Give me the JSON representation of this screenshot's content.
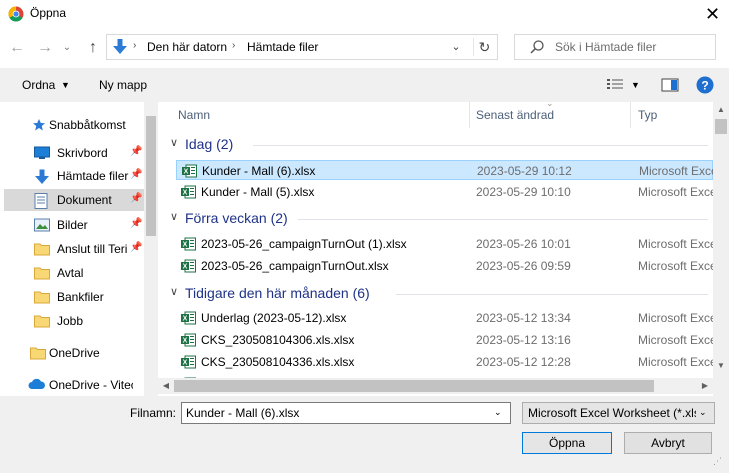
{
  "window": {
    "title": "Öppna"
  },
  "address": {
    "crumbs": [
      "Den här datorn",
      "Hämtade filer"
    ]
  },
  "search": {
    "placeholder": "Sök i Hämtade filer"
  },
  "toolbar": {
    "organize": "Ordna",
    "new_folder": "Ny mapp"
  },
  "nav": {
    "items": [
      {
        "label": "Snabbåtkomst",
        "icon": "star-icon"
      },
      {
        "label": "Skrivbord",
        "icon": "desktop-icon"
      },
      {
        "label": "Hämtade filer",
        "icon": "download-icon"
      },
      {
        "label": "Dokument",
        "icon": "document-icon"
      },
      {
        "label": "Bilder",
        "icon": "pictures-icon"
      },
      {
        "label": "Anslut till Teri",
        "icon": "folder-icon"
      },
      {
        "label": "Avtal",
        "icon": "folder-icon"
      },
      {
        "label": "Bankfiler",
        "icon": "folder-icon"
      },
      {
        "label": "Jobb",
        "icon": "folder-icon"
      },
      {
        "label": "OneDrive",
        "icon": "folder-icon"
      },
      {
        "label": "OneDrive - Vitecso",
        "icon": "cloud-icon"
      }
    ]
  },
  "columns": {
    "name": "Namn",
    "date": "Senast ändrad",
    "type": "Typ"
  },
  "groups": [
    {
      "title": "Idag (2)",
      "files": [
        {
          "name": "Kunder - Mall (6).xlsx",
          "date": "2023-05-29 10:12",
          "type": "Microsoft Excel"
        },
        {
          "name": "Kunder - Mall (5).xlsx",
          "date": "2023-05-29 10:10",
          "type": "Microsoft Excel"
        }
      ]
    },
    {
      "title": "Förra veckan (2)",
      "files": [
        {
          "name": "2023-05-26_campaignTurnOut (1).xlsx",
          "date": "2023-05-26 10:01",
          "type": "Microsoft Excel"
        },
        {
          "name": "2023-05-26_campaignTurnOut.xlsx",
          "date": "2023-05-26 09:59",
          "type": "Microsoft Excel"
        }
      ]
    },
    {
      "title": "Tidigare den här månaden (6)",
      "files": [
        {
          "name": "Underlag (2023-05-12).xlsx",
          "date": "2023-05-12 13:34",
          "type": "Microsoft Excel"
        },
        {
          "name": "CKS_230508104306.xls.xlsx",
          "date": "2023-05-12 13:16",
          "type": "Microsoft Excel"
        },
        {
          "name": "CKS_230508104336.xls.xlsx",
          "date": "2023-05-12 12:28",
          "type": "Microsoft Excel"
        }
      ]
    }
  ],
  "bottom": {
    "filename_label": "Filnamn:",
    "filename_value": "Kunder - Mall (6).xlsx",
    "filetype_value": "Microsoft Excel Worksheet (*.xlsx)",
    "open": "Öppna",
    "cancel": "Avbryt"
  },
  "colors": {
    "accent": "#0078d7",
    "selection": "#cce8ff",
    "group_text": "#1e3287"
  }
}
